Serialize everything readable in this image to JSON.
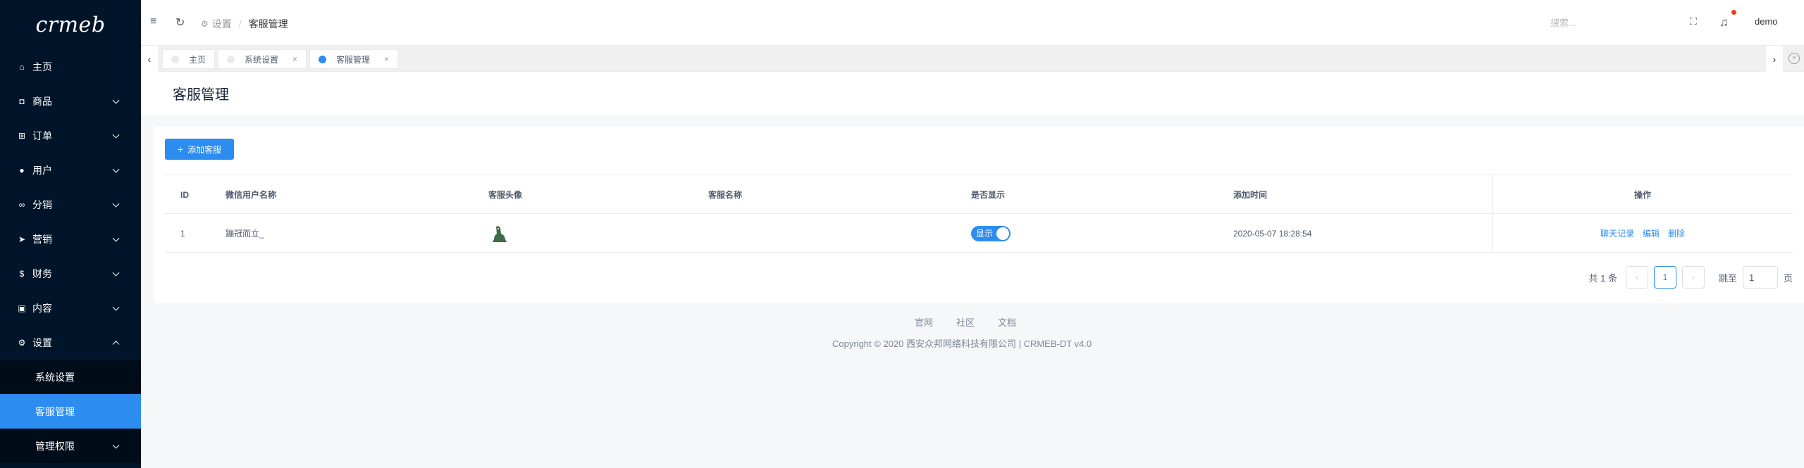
{
  "logo": "crmeb",
  "sidebar": {
    "items": [
      {
        "label": "主页",
        "icon": "home-icon"
      },
      {
        "label": "商品",
        "icon": "goods-icon"
      },
      {
        "label": "订单",
        "icon": "cart-icon"
      },
      {
        "label": "用户",
        "icon": "user-icon"
      },
      {
        "label": "分销",
        "icon": "distribution-icon"
      },
      {
        "label": "营销",
        "icon": "marketing-icon"
      },
      {
        "label": "财务",
        "icon": "finance-icon"
      },
      {
        "label": "内容",
        "icon": "content-icon"
      },
      {
        "label": "设置",
        "icon": "gear-icon"
      }
    ],
    "submenu": [
      {
        "label": "系统设置"
      },
      {
        "label": "客服管理"
      },
      {
        "label": "管理权限"
      }
    ]
  },
  "header": {
    "breadcrumb": [
      "设置",
      "客服管理"
    ],
    "search_placeholder": "搜索...",
    "user": "demo"
  },
  "tabs": [
    {
      "label": "主页"
    },
    {
      "label": "系统设置"
    },
    {
      "label": "客服管理"
    }
  ],
  "page_title": "客服管理",
  "add_button": "添加客服",
  "table": {
    "headers": [
      "ID",
      "微信用户名称",
      "客服头像",
      "客服名称",
      "是否显示",
      "添加时间",
      "操作"
    ],
    "rows": [
      {
        "id": "1",
        "wx_name": "蹦冠而立_",
        "name": "",
        "show_label": "显示",
        "time": "2020-05-07 18:28:54",
        "actions": [
          "聊天记录",
          "编辑",
          "删除"
        ]
      }
    ]
  },
  "pagination": {
    "total": "共 1 条",
    "current": "1",
    "jump_label": "跳至",
    "jump_value": "1",
    "page_unit": "页"
  },
  "footer": {
    "links": [
      "官网",
      "社区",
      "文档"
    ],
    "copyright": "Copyright © 2020 西安众邦网络科技有限公司 | CRMEB-DT v4.0"
  },
  "colors": {
    "sidebar_bg": "#001529",
    "accent": "#2d8cf0"
  }
}
